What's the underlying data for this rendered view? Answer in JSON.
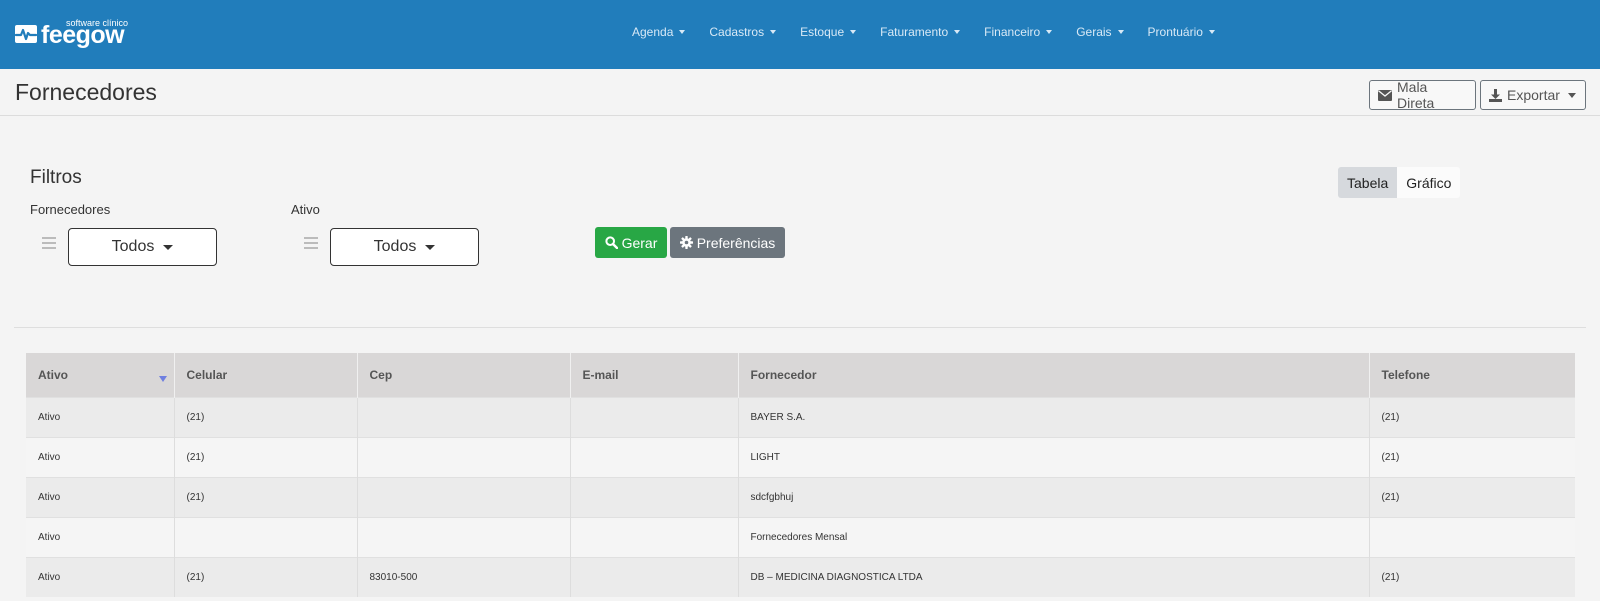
{
  "brand": {
    "name": "feegow",
    "tagline": "software clínico"
  },
  "nav": [
    {
      "label": "Agenda"
    },
    {
      "label": "Cadastros"
    },
    {
      "label": "Estoque"
    },
    {
      "label": "Faturamento"
    },
    {
      "label": "Financeiro"
    },
    {
      "label": "Gerais"
    },
    {
      "label": "Prontuário"
    }
  ],
  "header": {
    "title": "Fornecedores",
    "mala_direta_label": "Mala Direta",
    "exportar_label": "Exportar"
  },
  "filters": {
    "title": "Filtros",
    "fornecedores_label": "Fornecedores",
    "fornecedores_value": "Todos",
    "ativo_label": "Ativo",
    "ativo_value": "Todos",
    "gerar_label": "Gerar",
    "preferencias_label": "Preferências"
  },
  "view_toggle": {
    "tabela": "Tabela",
    "grafico": "Gráfico"
  },
  "table": {
    "columns": [
      "Ativo",
      "Celular",
      "Cep",
      "E-mail",
      "Fornecedor",
      "Telefone"
    ],
    "rows": [
      [
        "Ativo",
        "(21)",
        "",
        "",
        "BAYER S.A.",
        "(21)"
      ],
      [
        "Ativo",
        "(21)",
        "",
        "",
        "LIGHT",
        "(21)"
      ],
      [
        "Ativo",
        "(21)",
        "",
        "",
        "sdcfgbhuj",
        "(21)"
      ],
      [
        "Ativo",
        "",
        "",
        "",
        "Fornecedores Mensal",
        ""
      ],
      [
        "Ativo",
        "(21)",
        "83010-500",
        "",
        "DB – MEDICINA DIAGNOSTICA LTDA",
        "(21)"
      ]
    ]
  },
  "colors": {
    "navbar": "#217dbb",
    "gerar": "#28a745",
    "preferencias": "#6c757d",
    "sort_indicator": "#6f7fe0"
  },
  "icons": {
    "logo": "pulse-logo-icon",
    "mala_direta": "envelope-icon",
    "exportar": "download-icon",
    "gerar": "search-icon",
    "preferencias": "gear-icon",
    "drag": "drag-handle-icon",
    "sort": "sort-desc-icon"
  }
}
